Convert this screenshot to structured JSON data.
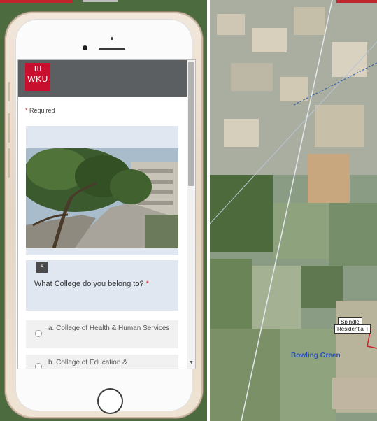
{
  "app": {
    "logo_emblem": "Ш",
    "logo_text": "WKU"
  },
  "form": {
    "required_star": "*",
    "required_label": "Required",
    "question": {
      "number": "6",
      "text": "What College do you belong to?",
      "star": "*"
    },
    "options": [
      {
        "label": "a. College of Health & Human Services"
      },
      {
        "label": "b. College of Education &"
      }
    ]
  },
  "map": {
    "label_line_1": "Spindle",
    "label_line_2": "Residential I",
    "city": "Bowling Green"
  },
  "icons": {
    "scroll_down": "▼"
  },
  "colors": {
    "brand_red": "#c8102e",
    "header_gray": "#5b5f62",
    "card_bg": "#e1e7f0",
    "required_red": "#d93025",
    "city_blue": "#2a50b8"
  }
}
